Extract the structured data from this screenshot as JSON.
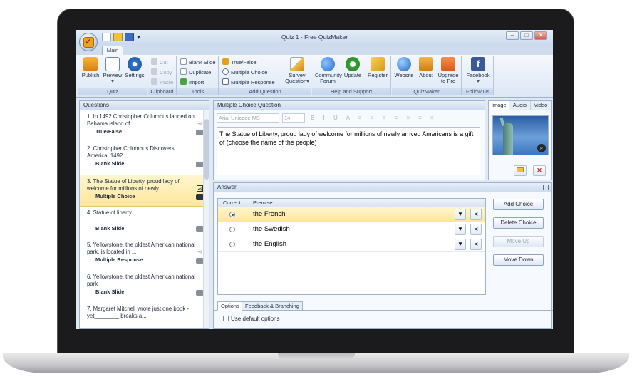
{
  "window": {
    "title": "Quiz 1 - Free QuizMaker",
    "controls": [
      "–",
      "□",
      "✕"
    ]
  },
  "ribbon": {
    "tab_main": "Main",
    "groups": {
      "quiz": {
        "label": "Quiz",
        "publish": "Publish",
        "preview": "Preview",
        "settings": "Settings"
      },
      "clipboard": {
        "label": "Clipboard",
        "cut": "Cut",
        "copy": "Copy",
        "paste": "Paste"
      },
      "tools": {
        "label": "Tools",
        "blank_slide": "Blank Slide",
        "duplicate": "Duplicate",
        "import": "Import"
      },
      "add_question": {
        "label": "Add Question",
        "true_false": "True/False",
        "multiple_choice": "Multiple Choice",
        "multiple_response": "Multiple Response",
        "survey_question_1": "Survey",
        "survey_question_2": "Question"
      },
      "help": {
        "label": "Help and Support",
        "community_1": "Community",
        "community_2": "Forum",
        "update": "Update",
        "register": "Register"
      },
      "quizmaker": {
        "label": "QuizMaker",
        "website": "Website",
        "about": "About",
        "upgrade_1": "Upgrade",
        "upgrade_2": "to Pro"
      },
      "follow": {
        "label": "Follow Us",
        "facebook": "Facebook"
      }
    }
  },
  "questions": {
    "header": "Questions",
    "items": [
      {
        "text": "1. In 1492 Christopher Columbus landed on Bahama island of...",
        "type": "True/False"
      },
      {
        "text": "2. Christopher Columbus Discovers America, 1492",
        "type": "Blank Slide"
      },
      {
        "text": "3. The Statue of Liberty, proud lady of welcome for millions of newly...",
        "type": "Multiple Choice"
      },
      {
        "text": "4. Statue of liberty",
        "type": "Blank Slide"
      },
      {
        "text": "5. Yellowstone, the oldest American national park, is located in ...",
        "type": "Multiple Response"
      },
      {
        "text": "6. Yellowstone, the oldest American national park",
        "type": "Blank Slide"
      },
      {
        "text": "7. Margaret Mitchell wrote just one book - yet________ breaks a...",
        "type": ""
      }
    ]
  },
  "mc_question": {
    "header": "Multiple Choice Question",
    "font": "Arial Unicode MS",
    "size": "14",
    "format_buttons": "B I U A ≡ ≡ ≡ ≡ ≡ ≡ ≡",
    "text": "The Statue of Liberty, proud lady of welcome for millions of newly arrived Americans is a gift of (choose the name of the people)"
  },
  "media": {
    "tabs": [
      "Image",
      "Audio",
      "Video"
    ]
  },
  "answer": {
    "header": "Answer",
    "col_correct": "Correct",
    "col_premise": "Premise",
    "rows": [
      {
        "premise": "the French",
        "correct": true
      },
      {
        "premise": "the Swedish",
        "correct": false
      },
      {
        "premise": "the English",
        "correct": false
      }
    ],
    "buttons": {
      "add_choice": "Add Choice",
      "delete_choice": "Delete Choice",
      "move_up": "Move Up",
      "move_down": "Move Down"
    },
    "options_tab": "Options",
    "feedback_tab": "Feedback & Branching",
    "use_default": "Use default options"
  },
  "colors": {
    "accent": "#e9a321",
    "selection": "#ffe79a",
    "panel_border": "#9fb3cf"
  }
}
